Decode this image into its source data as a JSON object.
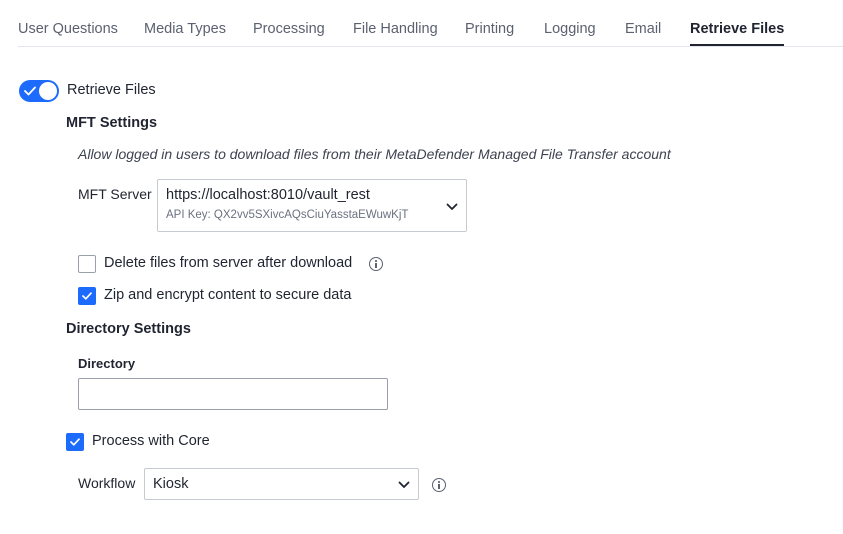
{
  "tabs": [
    {
      "label": "User Questions",
      "active": false
    },
    {
      "label": "Media Types",
      "active": false
    },
    {
      "label": "Processing",
      "active": false
    },
    {
      "label": "File Handling",
      "active": false
    },
    {
      "label": "Printing",
      "active": false
    },
    {
      "label": "Logging",
      "active": false
    },
    {
      "label": "Email",
      "active": false
    },
    {
      "label": "Retrieve Files",
      "active": true
    }
  ],
  "retrieve_toggle": {
    "label": "Retrieve Files",
    "enabled": true
  },
  "mft": {
    "heading": "MFT Settings",
    "description": "Allow logged in users to download files from their MetaDefender Managed File Transfer account",
    "server_label": "MFT Server",
    "server_value": "https://localhost:8010/vault_rest",
    "server_api_key": "API Key: QX2vv5SXivcAQsCiuYasstaEWuwKjT",
    "delete_label": "Delete files from server after download",
    "delete_checked": false,
    "zip_label": "Zip and encrypt content to secure data",
    "zip_checked": true
  },
  "directory": {
    "heading": "Directory Settings",
    "label": "Directory",
    "value": "",
    "process_label": "Process with Core",
    "process_checked": true,
    "workflow_label": "Workflow",
    "workflow_value": "Kiosk"
  },
  "colors": {
    "accent": "#1d6bfc",
    "text": "#1f2430",
    "border": "#c6cad1"
  },
  "icons": {
    "toggle": "check-icon",
    "select": "chevron-down-icon",
    "info": "info-icon"
  }
}
